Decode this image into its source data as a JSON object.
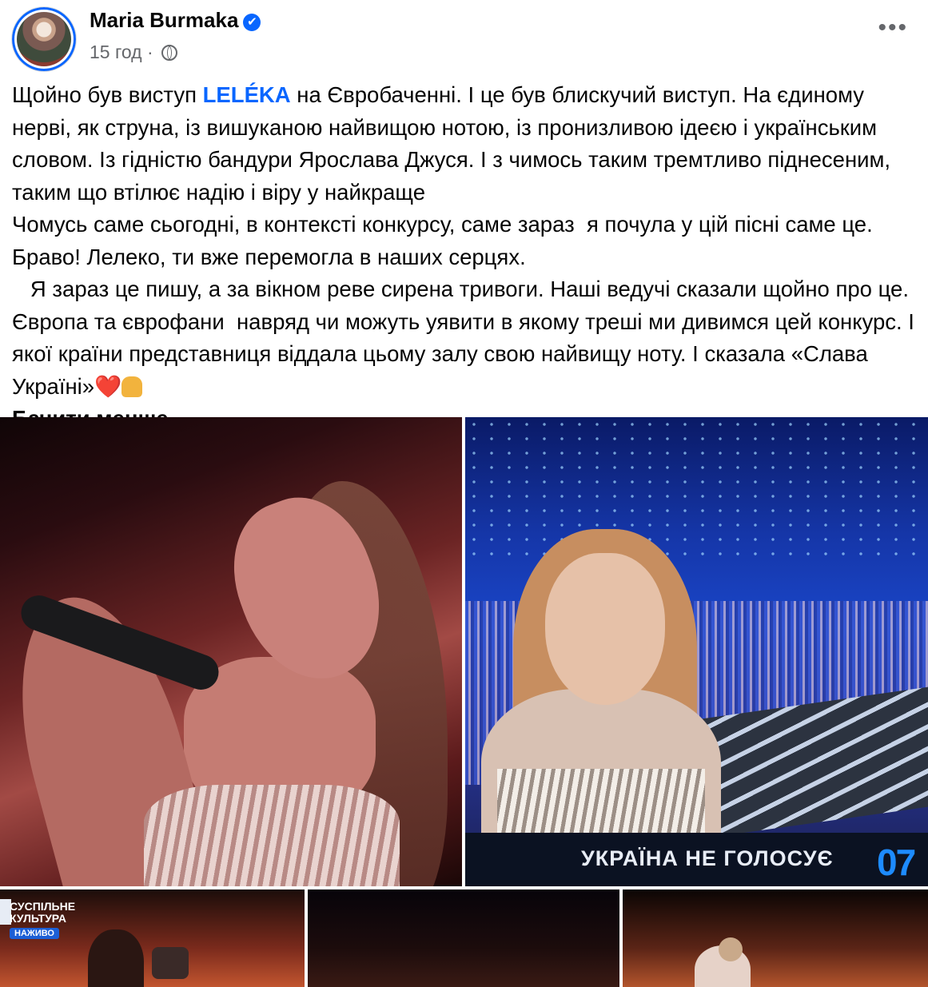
{
  "post": {
    "author": "Maria Burmaka",
    "verified_mark": "✔",
    "time": "15 год",
    "separator": "·",
    "privacy_icon": "globe-icon",
    "more_label": "•••",
    "text": {
      "p1_a": "Щойно був виступ ",
      "tag": "LELÉKA",
      "p1_b": " на Євробаченні. І це був блискучий виступ. На єдиному нерві, як струна, із вишуканою найвищою нотою, із пронизливою ідеєю і українським словом. Із гідністю бандури Ярослава Джуся. І з чимось таким тремтливо піднесеним, таким що втілює надію і віру у найкраще",
      "p2": "Чомусь саме сьогодні, в контексті конкурсу, саме зараз  я почула у цій пісні саме це.  Браво! Лелеко, ти вже перемогла в наших серцях.",
      "p3": "   Я зараз це пишу, а за вікном реве сирена тривоги. Наші ведучі сказали щойно про це. Європа та єврофани  навряд чи можуть уявити в якому треші ми дивимся цей конкурс. І якої країни представниця віддала цьому залу свою найвищу ноту. І сказала «Слава Україні»",
      "heart": "❤️",
      "see_less": "Бачити менше"
    }
  },
  "photos": {
    "photo2_caption": "УКРАЇНА НЕ ГОЛОСУЄ",
    "photo2_number": "07",
    "photo3_logo_line1": "СУСПІЛЬНЕ",
    "photo3_logo_line2": "КУЛЬТУРА",
    "photo3_live": "НАЖИВО"
  },
  "colors": {
    "link": "#0866ff",
    "secondary_text": "#65676b"
  }
}
